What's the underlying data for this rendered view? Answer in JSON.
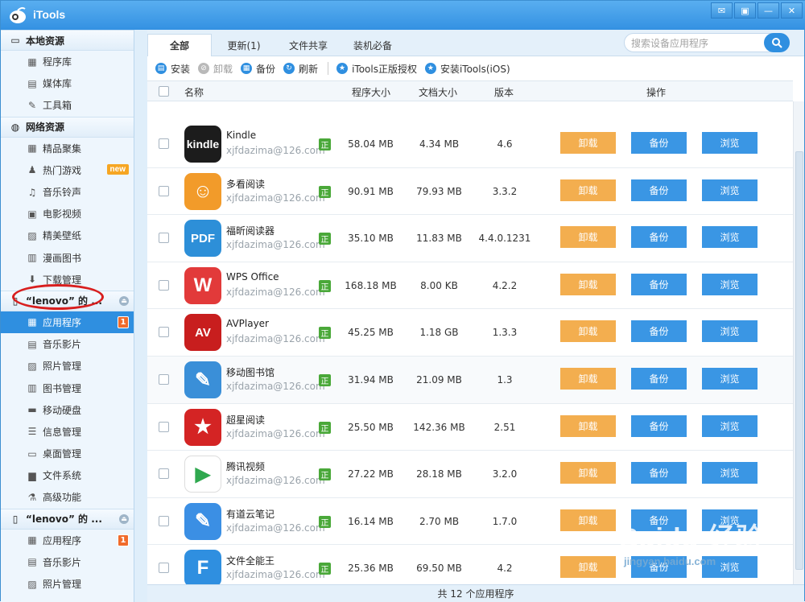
{
  "window": {
    "title": "iTools",
    "controls": [
      "message-icon",
      "skin-icon",
      "minimize-icon",
      "close-icon"
    ]
  },
  "sidebar": {
    "sections": [
      {
        "title": "本地资源",
        "icon": "computer-icon",
        "items": [
          {
            "label": "程序库",
            "icon": "grid-icon"
          },
          {
            "label": "媒体库",
            "icon": "film-icon"
          },
          {
            "label": "工具箱",
            "icon": "tools-icon"
          }
        ]
      },
      {
        "title": "网络资源",
        "icon": "globe-icon",
        "items": [
          {
            "label": "精品聚集",
            "icon": "grid-icon"
          },
          {
            "label": "热门游戏",
            "icon": "gamer-icon",
            "badge": "new"
          },
          {
            "label": "音乐铃声",
            "icon": "music-icon"
          },
          {
            "label": "电影视频",
            "icon": "video-icon"
          },
          {
            "label": "精美壁纸",
            "icon": "picture-icon"
          },
          {
            "label": "漫画图书",
            "icon": "book-icon"
          },
          {
            "label": "下载管理",
            "icon": "download-icon"
          }
        ]
      },
      {
        "title": "“lenovo” 的 ...",
        "icon": "phone-icon",
        "items": [
          {
            "label": "应用程序",
            "icon": "grid-icon",
            "badge": "1",
            "active": true
          },
          {
            "label": "音乐影片",
            "icon": "film-icon"
          },
          {
            "label": "照片管理",
            "icon": "picture-icon"
          },
          {
            "label": "图书管理",
            "icon": "book-icon"
          },
          {
            "label": "移动硬盘",
            "icon": "disk-icon"
          },
          {
            "label": "信息管理",
            "icon": "contact-icon"
          },
          {
            "label": "桌面管理",
            "icon": "desktop-icon"
          },
          {
            "label": "文件系统",
            "icon": "folder-icon"
          },
          {
            "label": "高级功能",
            "icon": "flask-icon"
          }
        ]
      },
      {
        "title": "“lenovo” 的 ...",
        "icon": "phone-icon",
        "items": [
          {
            "label": "应用程序",
            "icon": "grid-icon",
            "badge": "1"
          },
          {
            "label": "音乐影片",
            "icon": "film-icon"
          },
          {
            "label": "照片管理",
            "icon": "picture-icon"
          }
        ]
      }
    ]
  },
  "tabs": [
    "全部",
    "更新(1)",
    "文件共享",
    "装机必备"
  ],
  "search": {
    "placeholder": "搜索设备应用程序"
  },
  "toolbar": {
    "install": "安装",
    "uninstall": "卸载",
    "backup": "备份",
    "refresh": "刷新",
    "auth": "iTools正版授权",
    "install_ios": "安装iTools(iOS)"
  },
  "table": {
    "headers": {
      "name": "名称",
      "app_size": "程序大小",
      "doc_size": "文档大小",
      "version": "版本",
      "actions": "操作"
    },
    "buttons": {
      "uninstall": "卸载",
      "backup": "备份",
      "browse": "浏览"
    },
    "badge": "正",
    "rows": [
      {
        "name": "Kindle",
        "account": "xjfdazima@126.com",
        "app_size": "58.04 MB",
        "doc_size": "4.34 MB",
        "version": "4.6",
        "icon_text": "kindle",
        "icon_color": "#1c1c1c"
      },
      {
        "name": "多看阅读",
        "account": "xjfdazima@126.com",
        "app_size": "90.91 MB",
        "doc_size": "79.93 MB",
        "version": "3.3.2",
        "icon_text": "☺",
        "icon_color": "#f29b2a"
      },
      {
        "name": "福昕阅读器",
        "account": "xjfdazima@126.com",
        "app_size": "35.10 MB",
        "doc_size": "11.83 MB",
        "version": "4.4.0.1231",
        "icon_text": "PDF",
        "icon_color": "#2d8fd8"
      },
      {
        "name": "WPS Office",
        "account": "xjfdazima@126.com",
        "app_size": "168.18 MB",
        "doc_size": "8.00 KB",
        "version": "4.2.2",
        "icon_text": "W",
        "icon_color": "#e23a3a"
      },
      {
        "name": "AVPlayer",
        "account": "xjfdazima@126.com",
        "app_size": "45.25 MB",
        "doc_size": "1.18 GB",
        "version": "1.3.3",
        "icon_text": "AV",
        "icon_color": "#c81e1e"
      },
      {
        "name": "移动图书馆",
        "account": "xjfdazima@126.com",
        "app_size": "31.94 MB",
        "doc_size": "21.09 MB",
        "version": "1.3",
        "icon_text": "✎",
        "icon_color": "#3a8fd8"
      },
      {
        "name": "超星阅读",
        "account": "xjfdazima@126.com",
        "app_size": "25.50 MB",
        "doc_size": "142.36 MB",
        "version": "2.51",
        "icon_text": "★",
        "icon_color": "#d42424"
      },
      {
        "name": "腾讯视频",
        "account": "xjfdazima@126.com",
        "app_size": "27.22 MB",
        "doc_size": "28.18 MB",
        "version": "3.2.0",
        "icon_text": "▶",
        "icon_color": "#ffffff"
      },
      {
        "name": "有道云笔记",
        "account": "xjfdazima@126.com",
        "app_size": "16.14 MB",
        "doc_size": "2.70 MB",
        "version": "1.7.0",
        "icon_text": "✎",
        "icon_color": "#3b8fe4"
      },
      {
        "name": "文件全能王",
        "account": "xjfdazima@126.com",
        "app_size": "25.36 MB",
        "doc_size": "69.50 MB",
        "version": "4.2",
        "icon_text": "F",
        "icon_color": "#2f8fe0"
      }
    ]
  },
  "footer": {
    "count_text": "共 12 个应用程序"
  },
  "watermark": {
    "text": "Baidu 经验",
    "url_text": "jingyan.baidu.com"
  }
}
